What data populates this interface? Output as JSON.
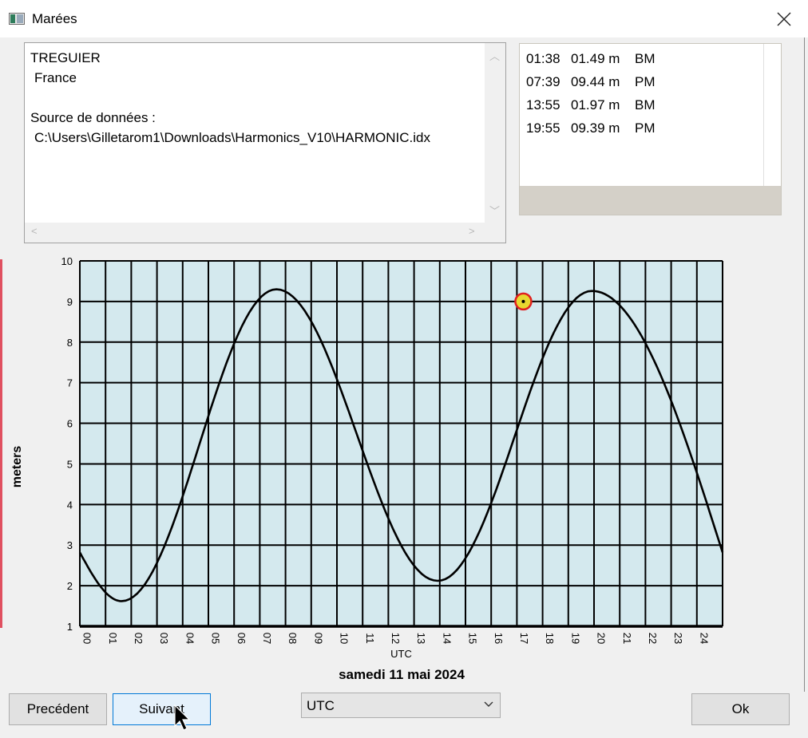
{
  "window": {
    "title": "Marées",
    "close_icon": "close-icon",
    "app_icon": "app-icon"
  },
  "info": {
    "station": "TREGUIER",
    "country": "France",
    "source_label": "Source de données :",
    "source_path": "C:\\Users\\Gilletarom1\\Downloads\\Harmonics_V10\\HARMONIC.idx"
  },
  "tides": [
    {
      "time": "01:38",
      "height": "01.49 m",
      "type": "BM"
    },
    {
      "time": "07:39",
      "height": "09.44 m",
      "type": "PM"
    },
    {
      "time": "13:55",
      "height": "01.97 m",
      "type": "BM"
    },
    {
      "time": "19:55",
      "height": "09.39 m",
      "type": "PM"
    }
  ],
  "chart_data": {
    "type": "line",
    "ylabel": "meters",
    "xlabel": "UTC",
    "ylim": [
      1,
      10
    ],
    "xlim": [
      0,
      25
    ],
    "y_ticks": [
      "10",
      "9",
      "8",
      "7",
      "6",
      "5",
      "4",
      "3",
      "2",
      "1"
    ],
    "x_ticks": [
      "00",
      "01",
      "02",
      "03",
      "04",
      "05",
      "06",
      "07",
      "08",
      "09",
      "10",
      "11",
      "12",
      "13",
      "14",
      "15",
      "16",
      "17",
      "18",
      "19",
      "20",
      "21",
      "22",
      "23",
      "24"
    ],
    "grid": true,
    "background_color": "#d4e9ee",
    "line_color": "#000000",
    "series": [
      {
        "values": [
          [
            0,
            2.82
          ],
          [
            1.63,
            1.62
          ],
          [
            7.65,
            9.3
          ],
          [
            13.92,
            2.12
          ],
          [
            19.92,
            9.26
          ],
          [
            25,
            2.82
          ]
        ]
      }
    ],
    "marker": {
      "x": 17.25,
      "y": 9.0,
      "color": "#e8d830",
      "ring_color": "#e02020",
      "icon": "current-position-marker"
    }
  },
  "date_label": "samedi 11 mai 2024",
  "buttons": {
    "previous": "Precédent",
    "next": "Suivant",
    "ok": "Ok"
  },
  "timezone": {
    "selected": "UTC"
  }
}
